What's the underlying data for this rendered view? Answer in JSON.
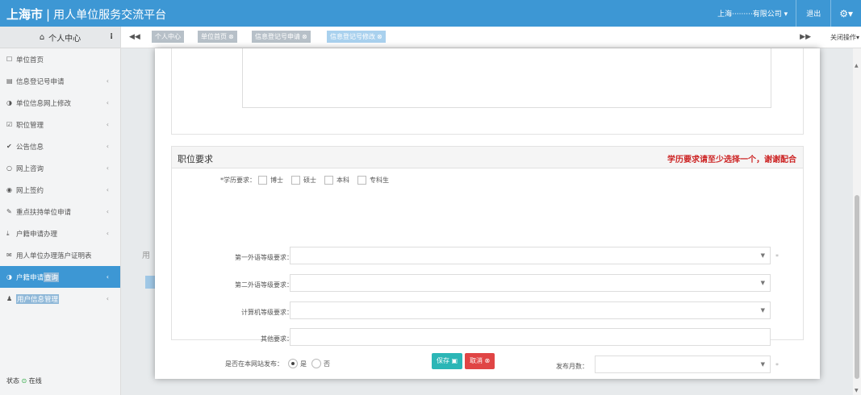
{
  "header": {
    "logo": "上海市",
    "title": "用人单位服务交流平台",
    "user_company": "上海·········有限公司",
    "logout": "退出",
    "gear_icon": "gear-icon"
  },
  "sidebar": {
    "head_label": "个人中心",
    "items": [
      {
        "label": "单位首页",
        "icon": "square-icon",
        "chevron": false
      },
      {
        "label": "信息登记号申请",
        "icon": "doc-icon",
        "chevron": true
      },
      {
        "label": "单位信息网上修改",
        "icon": "half-circle-icon",
        "chevron": true
      },
      {
        "label": "职位管理",
        "icon": "check-square-icon",
        "chevron": true
      },
      {
        "label": "公告信息",
        "icon": "check-icon",
        "chevron": true
      },
      {
        "label": "网上咨询",
        "icon": "circle-icon",
        "chevron": true
      },
      {
        "label": "网上签约",
        "icon": "eye-icon",
        "chevron": true
      },
      {
        "label": "重点扶持单位申请",
        "icon": "pencil-icon",
        "chevron": true
      },
      {
        "label": "户籍申请办理",
        "icon": "download-icon",
        "chevron": true
      },
      {
        "label": "用人单位办理落户证明表",
        "icon": "mail-icon",
        "chevron": false
      }
    ],
    "active_item": {
      "label_plain": "户籍申请",
      "label_highlight": "查询",
      "icon": "half-circle-icon"
    },
    "last_item": {
      "label_highlight": "用户信息管理",
      "icon": "user-icon"
    },
    "status_label": "状态",
    "status_value": "在线"
  },
  "tabs": {
    "items": [
      {
        "label": "个人中心",
        "closable": false,
        "active": false
      },
      {
        "label": "单位首页",
        "closable": true,
        "active": false
      },
      {
        "label": "信息登记号申请",
        "closable": true,
        "active": false
      },
      {
        "label": "信息登记号修改",
        "closable": true,
        "active": true
      }
    ],
    "close_ops": "关闭操作"
  },
  "modal": {
    "section_title": "职位要求",
    "warning": "学历要求请至少选择一个，谢谢配合",
    "education_label": "*学历要求：",
    "education_options": [
      "博士",
      "硕士",
      "本科",
      "专科生"
    ],
    "lang1_label": "第一外语等级要求：",
    "lang2_label": "第二外语等级要求：",
    "computer_label": "计算机等级要求：",
    "other_label": "其他要求：",
    "publish_label": "是否在本网站发布：",
    "publish_yes": "是",
    "publish_no": "否",
    "publish_selected": "是",
    "months_label": "发布月数：",
    "save_button": "保存",
    "cancel_button": "取消"
  }
}
